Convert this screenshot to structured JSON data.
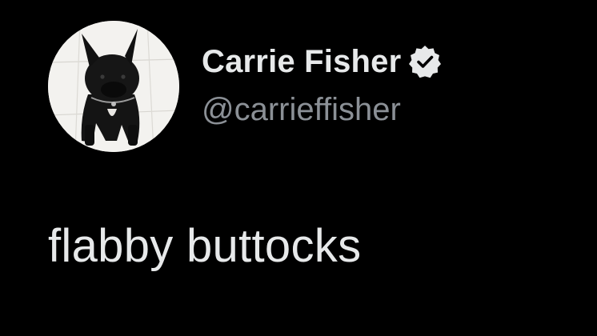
{
  "tweet": {
    "author": {
      "display_name": "Carrie Fisher",
      "handle": "@carrieffisher",
      "verified": true,
      "avatar_icon": "french-bulldog-avatar"
    },
    "text": "flabby buttocks"
  },
  "colors": {
    "background": "#000000",
    "primary_text": "#e7e9ea",
    "secondary_text": "#8b9096",
    "verified_badge": "#e7e9ea"
  }
}
